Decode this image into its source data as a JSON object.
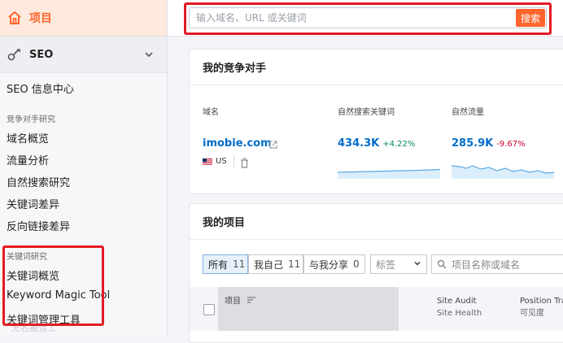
{
  "colors": {
    "accent": "#ff642d",
    "link": "#006dca",
    "positive": "#008c5a",
    "negative": "#d1002f",
    "highlight_box": "#e31b23"
  },
  "sidebar": {
    "projects_label": "项目",
    "seo_label": "SEO",
    "seo_items": [
      "SEO 信息中心"
    ],
    "competitor_section": "竞争对手研究",
    "competitor_items": [
      "域名概览",
      "流量分析",
      "自然搜索研究",
      "关键词差异",
      "反向链接差异"
    ],
    "keyword_section": "关键词研究",
    "keyword_items": [
      "关键词概览",
      "Keyword Magic Tool",
      "关键词管理工具"
    ],
    "watermark": "无名搬运工"
  },
  "search": {
    "placeholder": "输入域名、URL 或关键词",
    "value": "",
    "button": "搜索"
  },
  "competitors": {
    "title": "我的竞争对手",
    "columns": {
      "domain": "域名",
      "keywords": "自然搜索关键词",
      "traffic": "自然流量"
    },
    "row": {
      "domain": "imobie.com",
      "country": "US",
      "keywords_value": "434.3K",
      "keywords_delta": "+4.22%",
      "traffic_value": "285.9K",
      "traffic_delta": "-9.67%"
    }
  },
  "projects": {
    "title": "我的项目",
    "filters": [
      {
        "label": "所有",
        "count": "11"
      },
      {
        "label": "我自己",
        "count": "11"
      },
      {
        "label": "与我分享",
        "count": "0"
      }
    ],
    "tags_select": "标签",
    "search_placeholder": "项目名称或域名",
    "columns": {
      "project": "项目",
      "site_audit": "Site Audit",
      "site_health": "Site Health",
      "position_tracking": "Position Tra",
      "visibility": "可见度"
    }
  }
}
